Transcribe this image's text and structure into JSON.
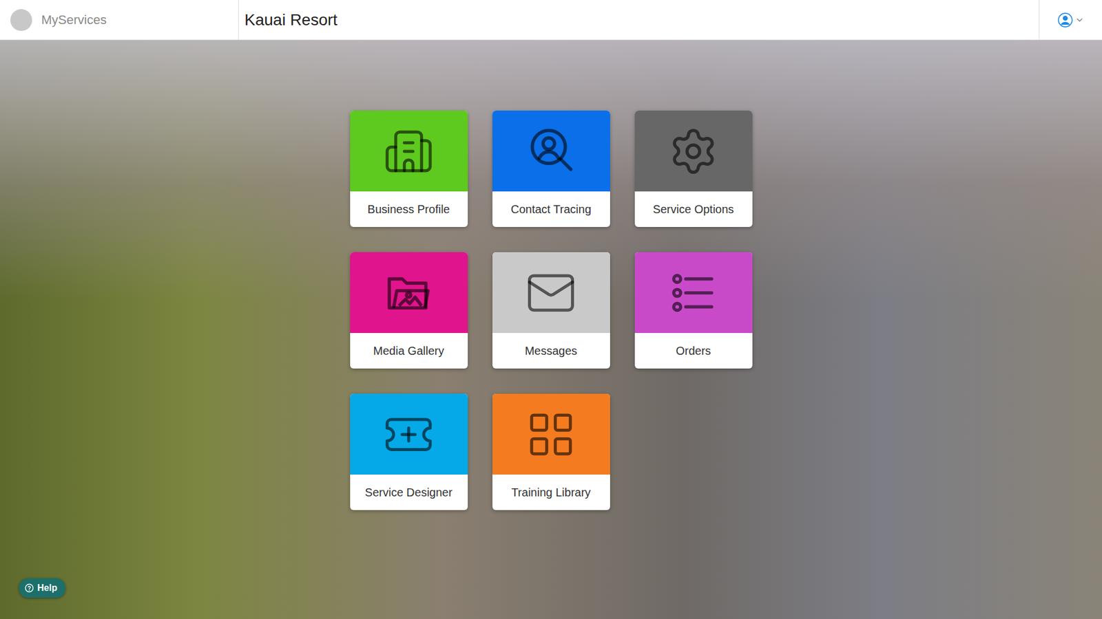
{
  "header": {
    "app_name": "MyServices",
    "title": "Kauai Resort"
  },
  "tiles": [
    {
      "label": "Business Profile",
      "color": "#5ec91f"
    },
    {
      "label": "Contact Tracing",
      "color": "#0a6fe8"
    },
    {
      "label": "Service Options",
      "color": "#676767"
    },
    {
      "label": "Media Gallery",
      "color": "#e0148c"
    },
    {
      "label": "Messages",
      "color": "#c9c9c9"
    },
    {
      "label": "Orders",
      "color": "#c94ac9"
    },
    {
      "label": "Service Designer",
      "color": "#05a9e8"
    },
    {
      "label": "Training Library",
      "color": "#f47b20"
    }
  ],
  "help_button": {
    "label": "Help"
  }
}
